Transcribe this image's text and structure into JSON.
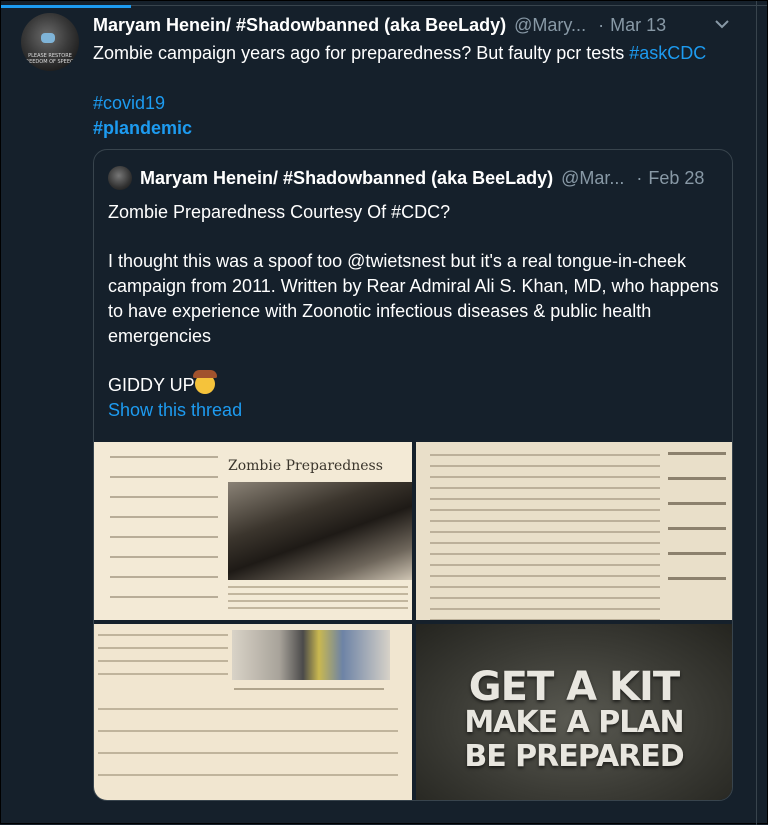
{
  "tweet": {
    "author_name": "Maryam Henein/ #Shadowbanned (aka BeeLady)",
    "handle": "@Mary...",
    "separator": "·",
    "date": "Mar 13",
    "text": "Zombie campaign years ago for preparedness? But faulty pcr tests ",
    "hashtag_inline": "#askCDC",
    "hashtag_covid": "#covid19",
    "hashtag_plandemic": "#plandemic",
    "avatar_caption": "PLEASE RESTORE\nFREEDOM OF SPEECH"
  },
  "quoted_tweet": {
    "author_name": "Maryam Henein/ #Shadowbanned (aka BeeLady)",
    "handle": "@Mar...",
    "separator": "·",
    "date": "Feb 28",
    "paragraph1": "Zombie Preparedness Courtesy Of #CDC?",
    "paragraph2": "I thought this was a spoof too @twietsnest  but it's a real tongue-in-cheek campaign from 2011. Written by Rear Admiral Ali S. Khan, MD, who happens to have experience with Zoonotic infectious diseases & public health emergencies",
    "paragraph3": "GIDDY UP",
    "show_thread": "Show this thread",
    "images": {
      "img1_title": "Zombie Preparedness",
      "kit_line1": "GET A KIT",
      "kit_line2": "MAKE A PLAN",
      "kit_line3": "BE PREPARED"
    }
  },
  "icons": {
    "menu": "chevron-down-icon",
    "emoji": "cowboy-face-emoji"
  },
  "colors": {
    "background": "#15202b",
    "accent": "#1d9bf0",
    "muted": "#8899a6",
    "border": "#38444d"
  }
}
